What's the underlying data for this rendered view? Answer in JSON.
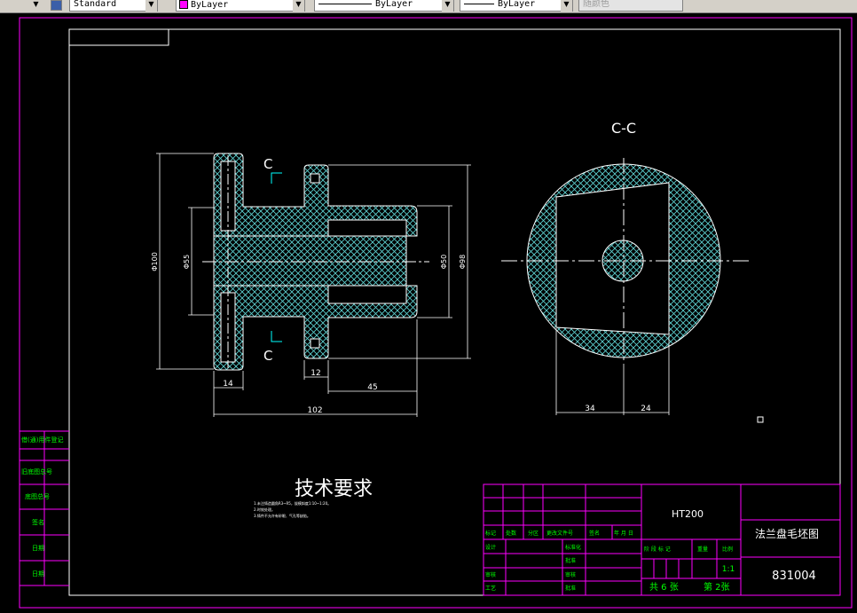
{
  "toolbar": {
    "text_style": "Standard",
    "layer": "ByLayer",
    "linetype": "ByLayer",
    "lineweight": "ByLayer",
    "color": "随颜色"
  },
  "drawing": {
    "section_label_top": "C",
    "section_label_bottom": "C",
    "section_title": "C-C",
    "dims": {
      "d100": "Φ100",
      "d55": "Φ55",
      "d50": "Φ50",
      "d98": "Φ98",
      "w14": "14",
      "w12": "12",
      "w45": "45",
      "w102": "102",
      "w34": "34",
      "w24": "24"
    },
    "tech_title": "技术要求",
    "tech_notes": [
      "1.未注铸造圆角R3~R5，拔模斜度1:10~1:20。",
      "2.时效处理。",
      "3.铸件不允许有砂眼、气孔等缺陷。"
    ]
  },
  "left_strip": [
    "借(通)用件登记",
    "旧底图总号",
    "底图总号",
    "签名",
    "日期",
    "日期"
  ],
  "title_block": {
    "material": "HT200",
    "drawing_name": "法兰盘毛坯图",
    "drawing_number": "831004",
    "scale": "1:1",
    "sheets_total": "共 6 张",
    "sheet_no": "第 2张",
    "row_headers": [
      "标记",
      "处数",
      "分区",
      "更改文件号",
      "签名",
      "年 月 日"
    ],
    "roles": [
      "设计",
      "审核",
      "工艺"
    ],
    "mid_roles": [
      "标准化",
      "批准",
      "审核",
      "批准"
    ],
    "stage_headers": [
      "阶 段 标 记",
      "重量",
      "比例"
    ]
  }
}
